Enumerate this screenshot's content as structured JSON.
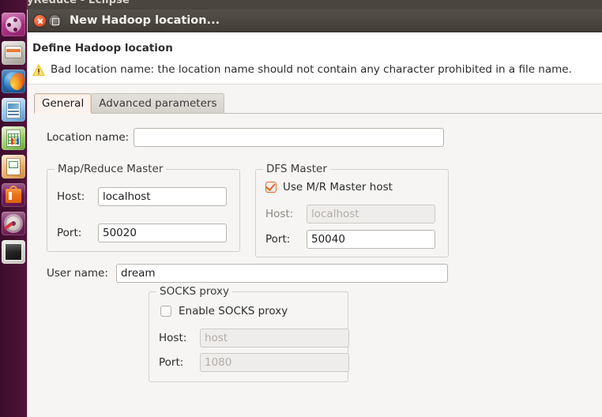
{
  "desktop": {
    "eclipse_window_title": "yReduce - Eclipse",
    "launcher": {
      "name": "unity-launcher",
      "items": [
        {
          "id": "dash",
          "label": "Ubuntu Dash",
          "icon": "ubuntu-dash-icon"
        },
        {
          "id": "files",
          "label": "Files",
          "icon": "files-icon"
        },
        {
          "id": "firefox",
          "label": "Firefox Web Browser",
          "icon": "firefox-icon"
        },
        {
          "id": "writer",
          "label": "LibreOffice Writer",
          "icon": "document-icon"
        },
        {
          "id": "calc",
          "label": "LibreOffice Calc",
          "icon": "spreadsheet-icon"
        },
        {
          "id": "impress",
          "label": "LibreOffice Impress",
          "icon": "presentation-icon"
        },
        {
          "id": "software",
          "label": "Ubuntu Software Center",
          "icon": "software-bag-icon"
        },
        {
          "id": "settings",
          "label": "System Settings",
          "icon": "gear-wrench-icon"
        },
        {
          "id": "terminal",
          "label": "Terminal",
          "icon": "terminal-icon"
        }
      ]
    }
  },
  "dialog": {
    "title": "New Hadoop location...",
    "titlebar": {
      "close_label": "Close",
      "maximize_label": "Maximize"
    },
    "header": {
      "title": "Define Hadoop location",
      "message": "Bad location name: the location name should not contain any character prohibited in a file name.",
      "message_icon": "warning-icon",
      "message_severity": "warning"
    },
    "tabs": [
      {
        "id": "general",
        "label": "General",
        "active": true
      },
      {
        "id": "advanced",
        "label": "Advanced parameters",
        "active": false
      }
    ],
    "general_tab": {
      "location_name": {
        "label": "Location name:",
        "value": "",
        "placeholder": ""
      },
      "mapreduce_master": {
        "legend": "Map/Reduce Master",
        "host": {
          "label": "Host:",
          "value": "localhost",
          "disabled": false
        },
        "port": {
          "label": "Port:",
          "value": "50020",
          "disabled": false
        }
      },
      "dfs_master": {
        "legend": "DFS Master",
        "use_mr_master_host": {
          "label": "Use M/R Master host",
          "checked": true
        },
        "host": {
          "label": "Host:",
          "value": "",
          "placeholder": "localhost",
          "disabled": true
        },
        "port": {
          "label": "Port:",
          "value": "50040",
          "disabled": false
        }
      },
      "user_name": {
        "label": "User name:",
        "value": "dream"
      },
      "socks_proxy": {
        "legend": "SOCKS proxy",
        "enable": {
          "label": "Enable SOCKS proxy",
          "checked": false
        },
        "host": {
          "label": "Host:",
          "value": "",
          "placeholder": "host",
          "disabled": true
        },
        "port": {
          "label": "Port:",
          "value": "",
          "placeholder": "1080",
          "disabled": true
        }
      }
    }
  },
  "colors": {
    "titlebar": "#4b463f",
    "close_button": "#e8562c",
    "checkbox_checked": "#e2672a",
    "active_tab_bg": "#fdf2ec",
    "warning_icon": "#f0c419",
    "launcher_bg": "#4a0f33",
    "dialog_bg": "#f6f5f4"
  }
}
